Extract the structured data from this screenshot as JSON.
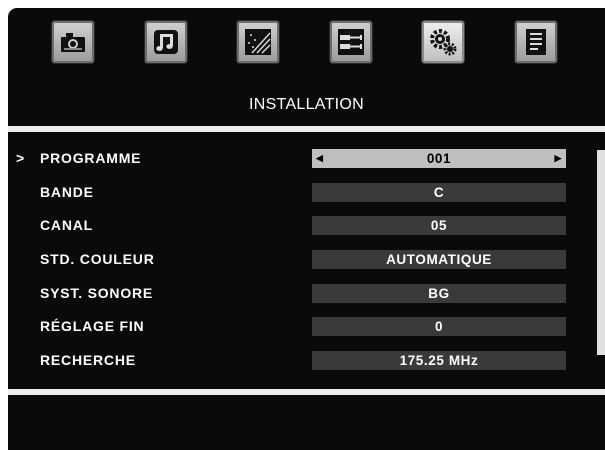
{
  "icons": [
    {
      "name": "camera-icon"
    },
    {
      "name": "music-note-icon"
    },
    {
      "name": "sparkle-picture-icon"
    },
    {
      "name": "connectors-icon"
    },
    {
      "name": "gears-icon"
    },
    {
      "name": "document-icon"
    }
  ],
  "menu": {
    "title": "INSTALLATION"
  },
  "cursor_glyph": ">",
  "settings": [
    {
      "label": "PROGRAMME",
      "value": "001",
      "selected": true
    },
    {
      "label": "BANDE",
      "value": "C"
    },
    {
      "label": "CANAL",
      "value": "05"
    },
    {
      "label": "STD. COULEUR",
      "value": "AUTOMATIQUE"
    },
    {
      "label": "SYST. SONORE",
      "value": "BG"
    },
    {
      "label": "RÉGLAGE FIN",
      "value": "0"
    },
    {
      "label": "RECHERCHE",
      "value": "175.25 MHz"
    }
  ],
  "colors": {
    "background": "#0a0a0a",
    "value_bar": "#3a3a3a",
    "value_bar_selected": "#bfbfbf",
    "text": "#ffffff"
  }
}
